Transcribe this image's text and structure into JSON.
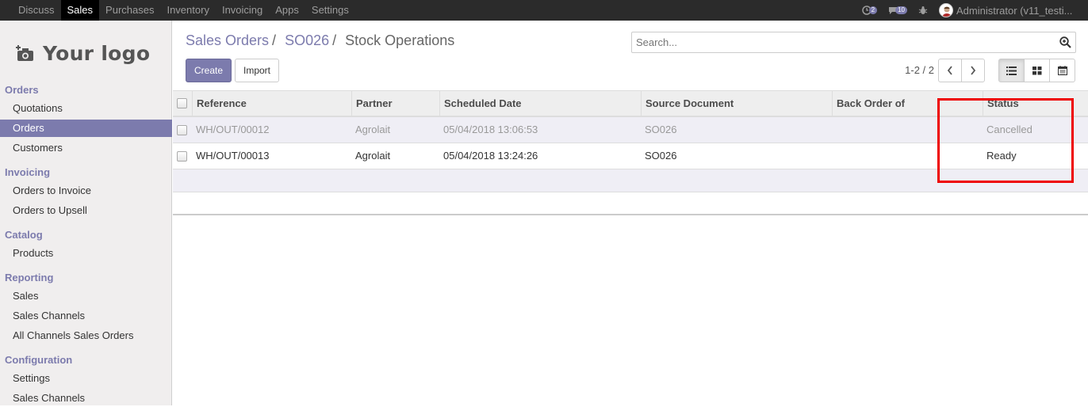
{
  "topbar": {
    "menu": [
      "Discuss",
      "Sales",
      "Purchases",
      "Inventory",
      "Invoicing",
      "Apps",
      "Settings"
    ],
    "active_menu": "Sales",
    "chat_badge": "2",
    "activity_badge": "10",
    "user": "Administrator (v11_testi..."
  },
  "sidebar": {
    "logo_text": "Your logo",
    "sections": [
      {
        "title": "Orders",
        "items": [
          "Quotations",
          "Orders",
          "Customers"
        ]
      },
      {
        "title": "Invoicing",
        "items": [
          "Orders to Invoice",
          "Orders to Upsell"
        ]
      },
      {
        "title": "Catalog",
        "items": [
          "Products"
        ]
      },
      {
        "title": "Reporting",
        "items": [
          "Sales",
          "Sales Channels",
          "All Channels Sales Orders"
        ]
      },
      {
        "title": "Configuration",
        "items": [
          "Settings",
          "Sales Channels"
        ]
      }
    ],
    "active_item": "Orders"
  },
  "breadcrumb": {
    "level1": "Sales Orders",
    "level2": "SO026",
    "current": "Stock Operations",
    "separator": "/"
  },
  "search": {
    "placeholder": "Search..."
  },
  "buttons": {
    "create": "Create",
    "import": "Import"
  },
  "pager": {
    "value": "1-2 / 2"
  },
  "table": {
    "columns": [
      "Reference",
      "Partner",
      "Scheduled Date",
      "Source Document",
      "Back Order of",
      "Status"
    ],
    "rows": [
      {
        "reference": "WH/OUT/00012",
        "partner": "Agrolait",
        "scheduled_date": "05/04/2018 13:06:53",
        "source": "SO026",
        "back_order": "",
        "status": "Cancelled"
      },
      {
        "reference": "WH/OUT/00013",
        "partner": "Agrolait",
        "scheduled_date": "05/04/2018 13:24:26",
        "source": "SO026",
        "back_order": "",
        "status": "Ready"
      }
    ]
  },
  "colors": {
    "accent": "#7c7bad",
    "topbar": "#2b2b2b",
    "highlight": "#ee0000"
  }
}
